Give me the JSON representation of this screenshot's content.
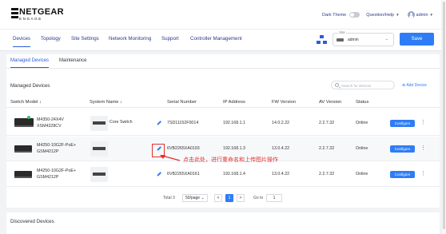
{
  "header": {
    "brand": "NETGEAR",
    "brand_sub": "ENGAGE",
    "dark_theme": "Dark Theme",
    "help": "Question/Help",
    "user": "admin"
  },
  "nav": {
    "items": [
      "Devices",
      "Topology",
      "Site Settings",
      "Network Monitoring",
      "Support",
      "Controller Management"
    ]
  },
  "site": {
    "label": "Site",
    "value": "admin"
  },
  "save_label": "Save",
  "tabs": [
    "Managed Devices",
    "Maintenance"
  ],
  "managed": {
    "title": "Managed Devices",
    "search_placeholder": "Search for devices",
    "add_device": "Add Device",
    "columns": [
      "Switch Model",
      "System Name",
      "Serial Number",
      "IP Address",
      "FW Version",
      "AV Version",
      "Status"
    ],
    "sort_arrow": "↓",
    "rows": [
      {
        "model_line1": "M4350-24X4V",
        "model_line2": "XSM4328CV",
        "system_name": "Core Switch",
        "serial": "7SD11152F0014",
        "ip": "192.168.1.1",
        "fw": "14.0.2.22",
        "av": "2.2.7.32",
        "status": "Online",
        "action": "Configure"
      },
      {
        "model_line1": "M4250-10G2F-PoE+",
        "model_line2": "GSM4212P",
        "system_name": "",
        "serial": "6VB2265XA0193",
        "ip": "192.168.1.3",
        "fw": "13.0.4.22",
        "av": "2.2.7.32",
        "status": "Online",
        "action": "Configure"
      },
      {
        "model_line1": "M4250-10G2F-PoE+",
        "model_line2": "GSM4212P",
        "system_name": "",
        "serial": "6VB2265XA0161",
        "ip": "192.168.1.4",
        "fw": "13.0.4.22",
        "av": "2.2.7.32",
        "status": "Online",
        "action": "Configure"
      }
    ]
  },
  "pagination": {
    "total": "Total 3",
    "per_page": "50/page",
    "prev": "<",
    "current": "1",
    "next": ">",
    "goto_label": "Go to",
    "goto_value": "1"
  },
  "annotation": "点击此处，进行重命名和上传图片操作",
  "discovered_title": "Discovered Devices",
  "colors": {
    "accent": "#2f7df6",
    "nav_text": "#2d3a8c",
    "annotation": "#e0322c",
    "status_dot": "#35c26b"
  }
}
